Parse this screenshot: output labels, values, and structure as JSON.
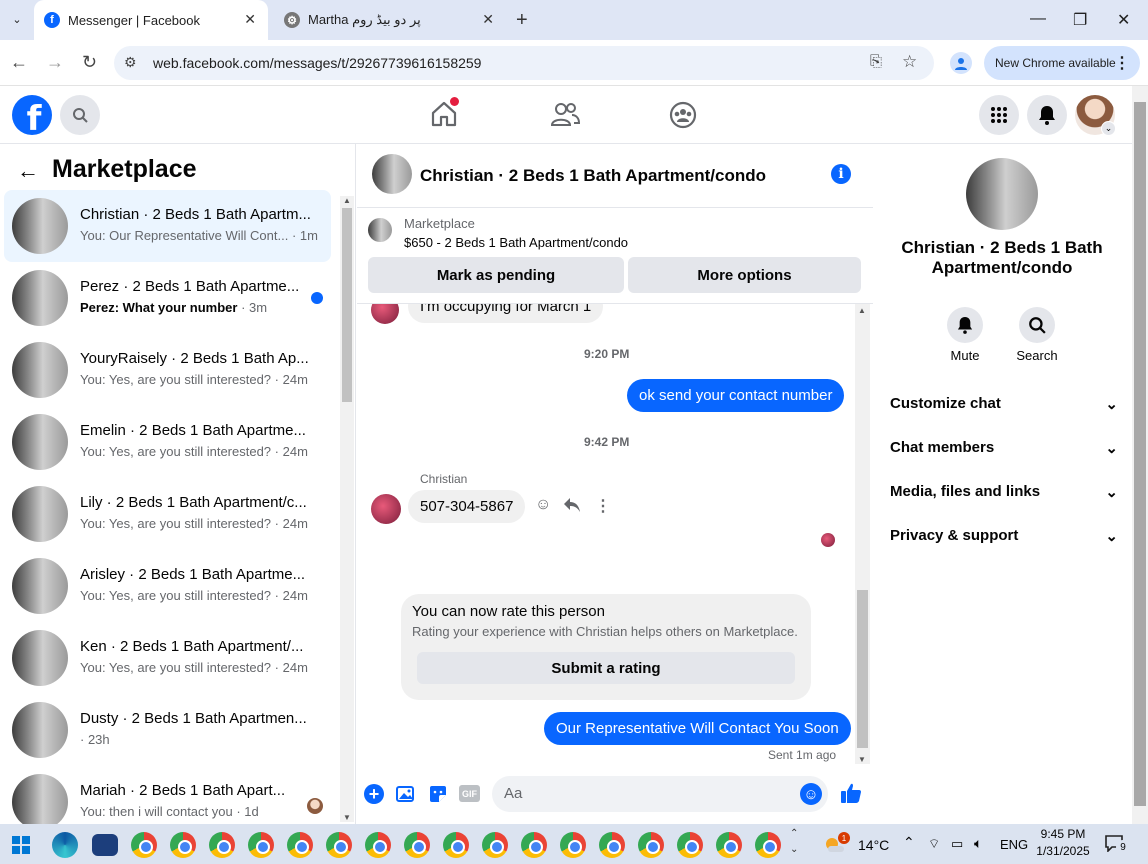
{
  "browser": {
    "tabs": [
      {
        "title": "Messenger | Facebook",
        "active": true
      },
      {
        "title": "Martha پر دو بیڈ روم",
        "active": false
      }
    ],
    "url": "web.facebook.com/messages/t/29267739616158259",
    "update_label": "New Chrome available"
  },
  "sidebar": {
    "title": "Marketplace",
    "conversations": [
      {
        "name": "Christian · 2 Beds 1 Bath Apartm...",
        "preview": "You: Our Representative Will Cont...",
        "time": "· 1m",
        "active": true,
        "unread": false
      },
      {
        "name": "Perez · 2 Beds 1 Bath Apartme...",
        "preview": "Perez: What your number",
        "time": "· 3m",
        "active": false,
        "unread": true
      },
      {
        "name": "YouryRaisely · 2 Beds 1 Bath Ap...",
        "preview": "You: Yes, are you still interested?",
        "time": "· 24m",
        "active": false,
        "unread": false
      },
      {
        "name": "Emelin · 2 Beds 1 Bath Apartme...",
        "preview": "You: Yes, are you still interested?",
        "time": "· 24m",
        "active": false,
        "unread": false
      },
      {
        "name": "Lily · 2 Beds 1 Bath Apartment/c...",
        "preview": "You: Yes, are you still interested?",
        "time": "· 24m",
        "active": false,
        "unread": false
      },
      {
        "name": "Arisley · 2 Beds 1 Bath Apartme...",
        "preview": "You: Yes, are you still interested?",
        "time": "· 24m",
        "active": false,
        "unread": false
      },
      {
        "name": "Ken · 2 Beds 1 Bath Apartment/...",
        "preview": "You: Yes, are you still interested?",
        "time": "· 24m",
        "active": false,
        "unread": false
      },
      {
        "name": "Dusty · 2 Beds 1 Bath Apartmen...",
        "preview": "",
        "time": "· 23h",
        "active": false,
        "unread": false
      },
      {
        "name": "Mariah · 2 Beds 1 Bath Apart...",
        "preview": "You: then i will contact you",
        "time": "· 1d",
        "active": false,
        "unread": false
      }
    ]
  },
  "chat": {
    "title": "Christian · 2 Beds 1 Bath Apartment/condo",
    "listing_source": "Marketplace",
    "listing": "$650 - 2 Beds 1 Bath Apartment/condo",
    "mark_pending": "Mark as pending",
    "more_options": "More options",
    "msg_partial": "I'm occupying for March 1",
    "time1": "9:20 PM",
    "msg_out1": "ok send your contact number",
    "time2": "9:42 PM",
    "sender": "Christian",
    "msg_in2": "507-304-5867",
    "rate_title": "You can now rate this person",
    "rate_desc": "Rating your experience with Christian helps others on Marketplace.",
    "rate_button": "Submit a rating",
    "msg_out2": "Our Representative Will Contact You Soon",
    "sent_status": "Sent 1m ago",
    "composer_placeholder": "Aa"
  },
  "panel": {
    "name": "Christian · 2 Beds 1 Bath Apartment/condo",
    "mute": "Mute",
    "search": "Search",
    "sections": [
      "Customize chat",
      "Chat members",
      "Media, files and links",
      "Privacy & support"
    ]
  },
  "taskbar": {
    "temp": "14°C",
    "lang": "ENG",
    "time": "9:45 PM",
    "date": "1/31/2025",
    "weather_badge": "1",
    "notif_count": "9"
  },
  "colors": {
    "fb_blue": "#0866ff",
    "bubble_out": "#0866ff",
    "active_conv": "#ebf5ff"
  }
}
